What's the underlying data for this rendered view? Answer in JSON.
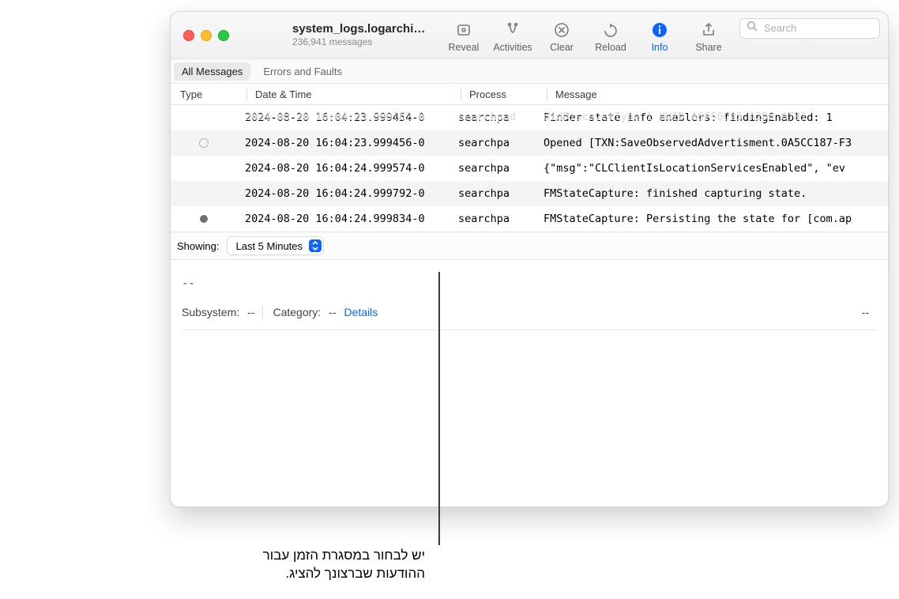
{
  "window": {
    "title": "system_logs.logarchi…",
    "subtitle": "236,941 messages"
  },
  "toolbar": {
    "reveal": "Reveal",
    "activities": "Activities",
    "clear": "Clear",
    "reload": "Reload",
    "info": "Info",
    "share": "Share",
    "search_placeholder": "Search"
  },
  "filters": {
    "all": "All Messages",
    "errors": "Errors and Faults"
  },
  "columns": {
    "type": "Type",
    "date": "Date & Time",
    "process": "Process",
    "message": "Message"
  },
  "ghost": {
    "date": "2024-08-20 16:04:23.999162-0",
    "process": "searchpad",
    "message": "didDiscoverType 1 UUID A6F56C95-A2D8-07B1"
  },
  "rows": [
    {
      "type": "",
      "date": "2024-08-20 16:04:23.999454-0",
      "process": "searchpa",
      "message": "Finder state info enablers:   findingEnabled: 1"
    },
    {
      "type": "hollow",
      "date": "2024-08-20 16:04:23.999456-0",
      "process": "searchpa",
      "message": "Opened [TXN:SaveObservedAdvertisment.0A5CC187-F3"
    },
    {
      "type": "",
      "date": "2024-08-20 16:04:24.999574-0",
      "process": "searchpa",
      "message": "{\"msg\":\"CLClientIsLocationServicesEnabled\", \"ev"
    },
    {
      "type": "",
      "date": "2024-08-20 16:04:24.999792-0",
      "process": "searchpa",
      "message": "FMStateCapture: finished capturing state."
    },
    {
      "type": "solid",
      "date": "2024-08-20 16:04:24.999834-0",
      "process": "searchpa",
      "message": "FMStateCapture: Persisting the state for [com.ap"
    }
  ],
  "showing": {
    "label": "Showing:",
    "value": "Last 5 Minutes"
  },
  "detail": {
    "dashes": "--",
    "subsystem_label": "Subsystem:",
    "subsystem_value": "--",
    "category_label": "Category:",
    "category_value": "--",
    "details_link": "Details",
    "right_value": "--"
  },
  "callout": {
    "line1": "יש לבחור במסגרת הזמן עבור",
    "line2": "ההודעות שברצונך להציג."
  }
}
